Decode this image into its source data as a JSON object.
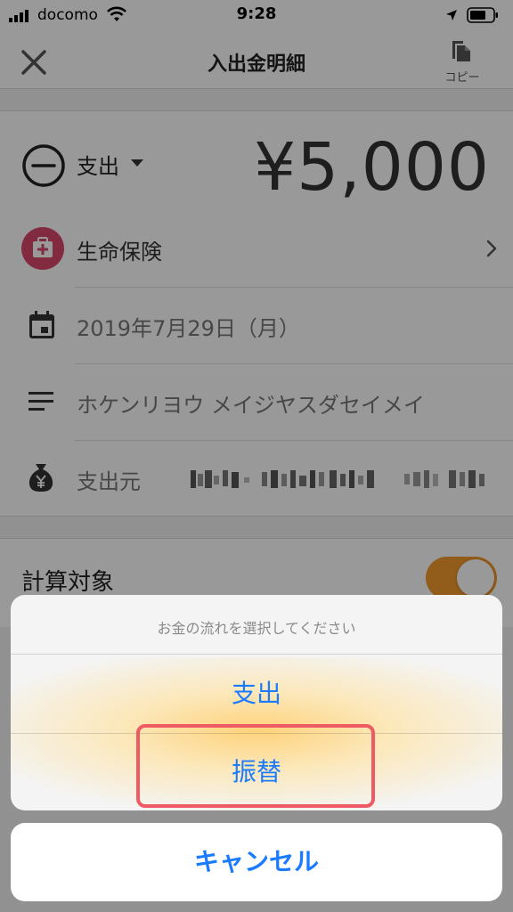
{
  "status_bar": {
    "carrier": "docomo",
    "time": "9:28"
  },
  "nav": {
    "title": "入出金明細",
    "copy_label": "コピー"
  },
  "transaction": {
    "type_label": "支出",
    "amount": "¥5,000",
    "category": "生命保険",
    "date": "2019年7月29日（月）",
    "memo": "ホケンリヨウ メイジヤスダセイメイ",
    "source_label": "支出元"
  },
  "calculation": {
    "label": "計算対象",
    "enabled": true
  },
  "action_sheet": {
    "title": "お金の流れを選択してください",
    "options": [
      "支出",
      "振替"
    ],
    "cancel_label": "キャンセル"
  },
  "colors": {
    "accent": "#1b7bff",
    "toggle_on": "#f39a2c",
    "category_icon": "#d9486b",
    "highlight": "#ef5b64"
  },
  "icons": [
    "signal-icon",
    "wifi-icon",
    "location-icon",
    "battery-icon",
    "close-icon",
    "copy-icon",
    "minus-circle-icon",
    "medical-kit-icon",
    "calendar-icon",
    "memo-lines-icon",
    "money-bag-icon",
    "chevron-right-icon"
  ]
}
